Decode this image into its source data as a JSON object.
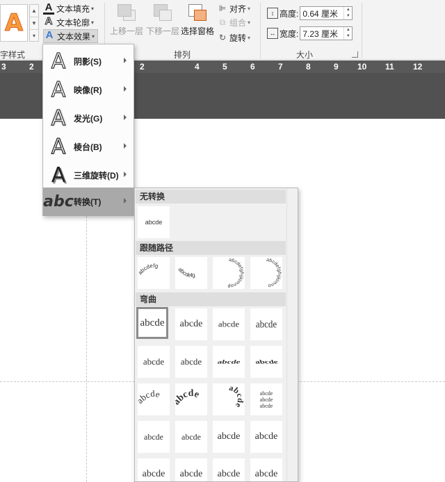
{
  "ribbon": {
    "wordart_group_label": "字样式",
    "text_fill": "文本填充",
    "text_outline": "文本轮廓",
    "text_effects": "文本效果",
    "arrange_group_label": "排列",
    "bring_forward": "上移一层",
    "send_backward": "下移一层",
    "selection_pane": "选择窗格",
    "align": "对齐",
    "group": "组合",
    "rotate": "旋转",
    "size_group_label": "大小",
    "height_label": "高度:",
    "height_value": "0.64 厘米",
    "width_label": "宽度:",
    "width_value": "7.23 厘米",
    "wordart_preview_letter": "A"
  },
  "ruler": {
    "left_numbers": [
      "3",
      "2"
    ],
    "right_numbers": [
      "2",
      "4",
      "5",
      "6",
      "7",
      "8",
      "9",
      "10",
      "11",
      "12"
    ]
  },
  "effects_menu": {
    "items": [
      {
        "label": "阴影(S)",
        "icon": "shadow-icon"
      },
      {
        "label": "映像(R)",
        "icon": "reflection-icon"
      },
      {
        "label": "发光(G)",
        "icon": "glow-icon"
      },
      {
        "label": "棱台(B)",
        "icon": "bevel-icon"
      },
      {
        "label": "三维旋转(D)",
        "icon": "3d-rotation-icon"
      },
      {
        "label": "转换(T)",
        "icon": "transform-icon"
      }
    ],
    "icon_letter": "A",
    "transform_icon_text": "abc"
  },
  "transform_gallery": {
    "no_transform_header": "无转换",
    "follow_path_header": "跟随路径",
    "warp_header": "弯曲",
    "sample_text": "abcde",
    "path_text": "abcdefg",
    "circle_text": "abcdefghijklmnop",
    "button_text": "abcdefghijklmno",
    "warp_sample": "abcde",
    "mini_sample": "abcde"
  },
  "colors": {
    "ribbon_bg": "#f3f3f3",
    "ruler_bg": "#595959",
    "dark_band": "#515151",
    "menu_selected": "#a9a9a9",
    "wordart_orange": "#f79a3e"
  }
}
